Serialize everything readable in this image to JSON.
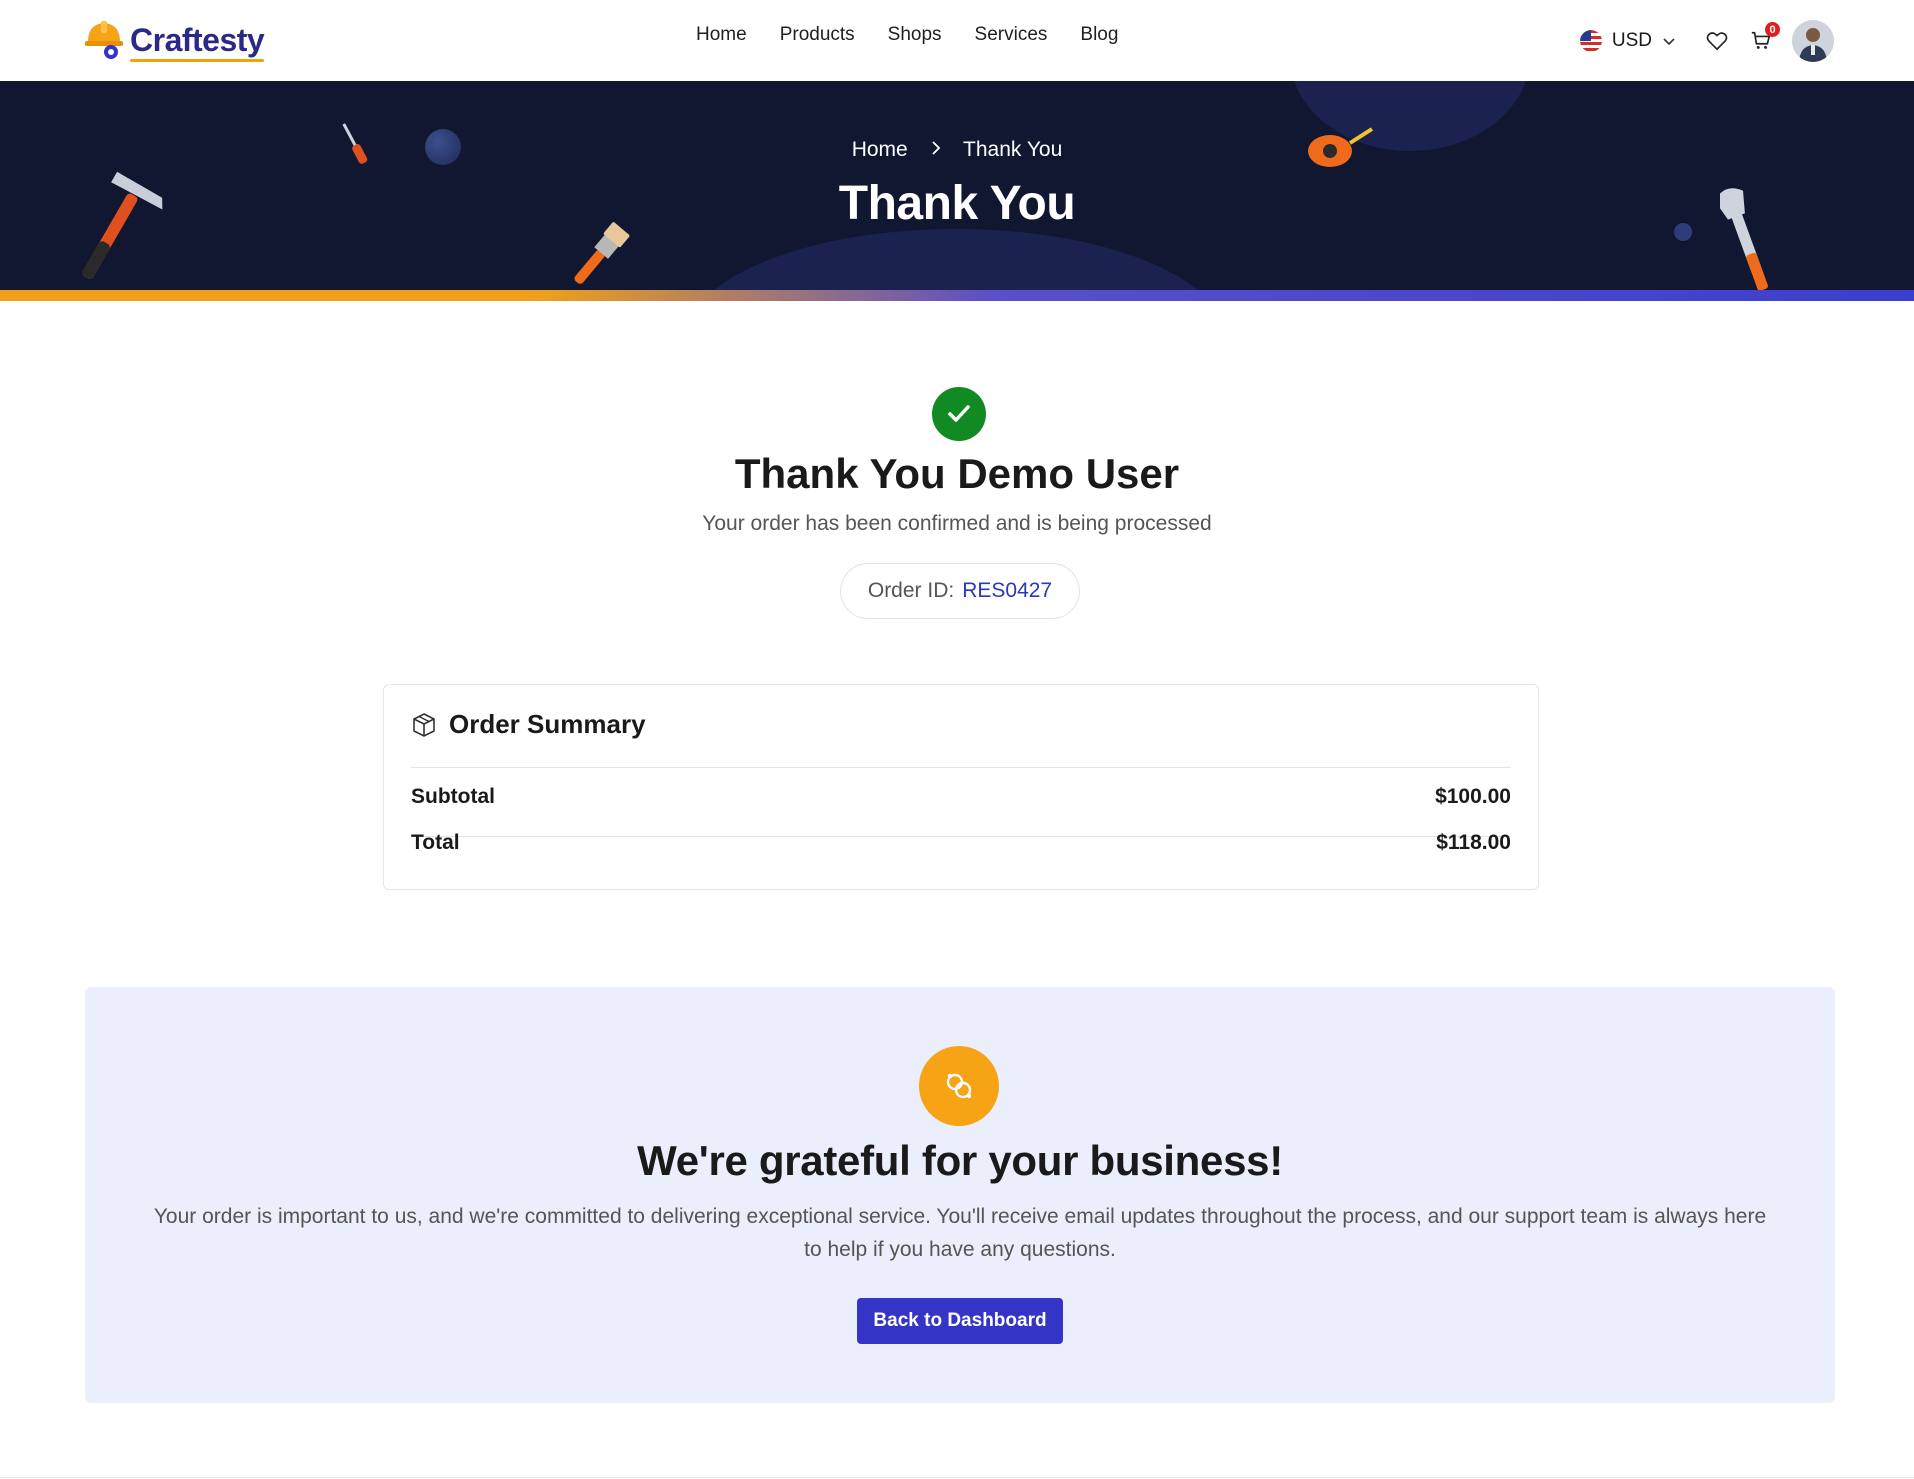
{
  "brand": {
    "name": "Craftesty"
  },
  "nav": {
    "items": [
      "Home",
      "Products",
      "Shops",
      "Services",
      "Blog"
    ]
  },
  "header_tools": {
    "currency": "USD",
    "cart_count": "0"
  },
  "hero": {
    "breadcrumb": {
      "home": "Home",
      "current": "Thank You"
    },
    "title": "Thank You"
  },
  "confirmation": {
    "title": "Thank You Demo User",
    "subtitle": "Your order has been confirmed and is being processed",
    "order_id_label": "Order ID:",
    "order_id": "RES0427"
  },
  "summary": {
    "title": "Order Summary",
    "rows": [
      {
        "label": "Subtotal",
        "value": "$100.00"
      },
      {
        "label": "Total",
        "value": "$118.00"
      }
    ]
  },
  "grateful": {
    "title": "We're grateful for your business!",
    "text": "Your order is important to us, and we're committed to delivering exceptional service. You'll receive email updates throughout the process, and our support team is always here to help if you have any questions.",
    "button_label": "Back to Dashboard"
  },
  "colors": {
    "accent_blue": "#3434c7",
    "accent_orange": "#f7a316",
    "hero_bg": "#111631",
    "success_green": "#128a24",
    "section_bg": "#ebeefb"
  }
}
